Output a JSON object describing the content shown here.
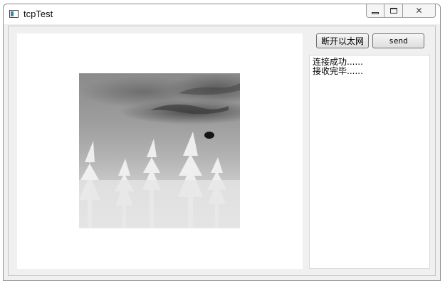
{
  "window": {
    "title": "tcpTest",
    "icons": {
      "app": "qt-window-icon",
      "minimize": "minimize-icon",
      "maximize": "maximize-icon",
      "close": "close-icon",
      "close_glyph": "✕"
    }
  },
  "toolbar": {
    "disconnect_label": "断开以太网",
    "send_label": "send"
  },
  "log": {
    "lines": [
      "连接成功......",
      "接收完毕......"
    ]
  },
  "image": {
    "description_icon": "photo-view"
  }
}
